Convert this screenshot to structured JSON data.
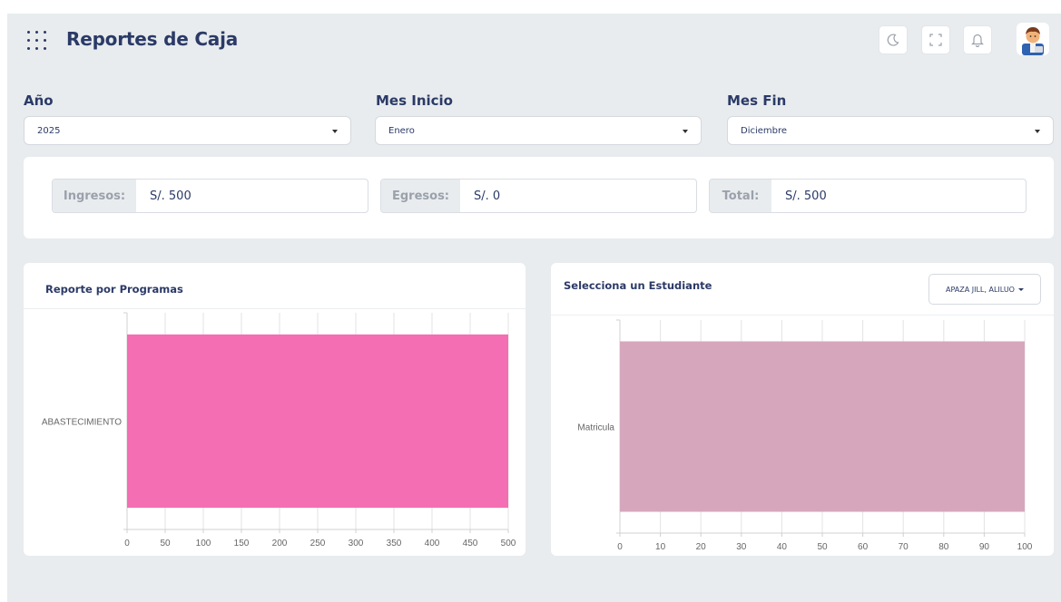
{
  "header": {
    "title": "Reportes de Caja",
    "icons": [
      "grid-icon",
      "moon-icon",
      "fullscreen-icon",
      "bell-icon",
      "avatar"
    ]
  },
  "filters": {
    "year": {
      "label": "Año",
      "value": "2025"
    },
    "start_month": {
      "label": "Mes Inicio",
      "value": "Enero"
    },
    "end_month": {
      "label": "Mes Fin",
      "value": "Diciembre"
    }
  },
  "summary": {
    "income": {
      "label": "Ingresos:",
      "value": "S/. 500"
    },
    "expenses": {
      "label": "Egresos:",
      "value": "S/. 0"
    },
    "total": {
      "label": "Total:",
      "value": "S/. 500"
    }
  },
  "program_card": {
    "title": "Reporte por Programas"
  },
  "student_card": {
    "title": "Selecciona un Estudiante",
    "selected_student": "APAZA JILL, ALILUO"
  },
  "colors": {
    "accent": "#2b3a67",
    "program_bar": "#f46eb3",
    "student_bar": "#d6a7bc",
    "background": "#e8ecee"
  },
  "chart_data": [
    {
      "type": "bar",
      "orientation": "horizontal",
      "categories": [
        "ABASTECIMIENTO"
      ],
      "values": [
        500
      ],
      "xlim": [
        0,
        500
      ],
      "xticks": [
        "0",
        "50",
        "100",
        "150",
        "200",
        "250",
        "300",
        "350",
        "400",
        "450",
        "500"
      ],
      "grid": true
    },
    {
      "type": "bar",
      "orientation": "horizontal",
      "categories": [
        "Matricula"
      ],
      "values": [
        100
      ],
      "xlim": [
        0,
        100
      ],
      "xticks": [
        "0",
        "10",
        "20",
        "30",
        "40",
        "50",
        "60",
        "70",
        "80",
        "90",
        "100"
      ],
      "grid": true
    }
  ]
}
